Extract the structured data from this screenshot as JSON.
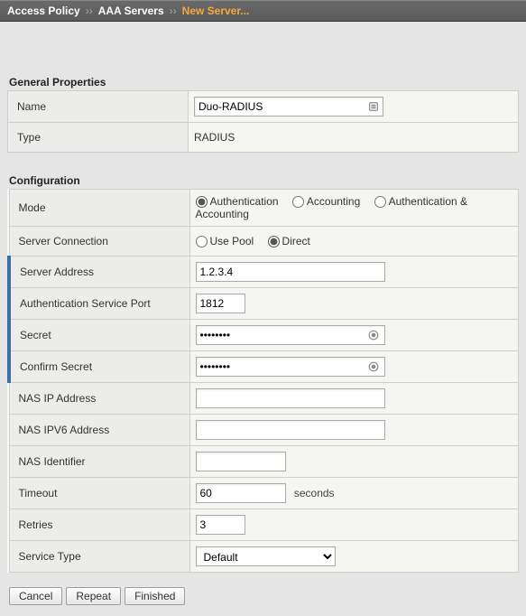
{
  "breadcrumb": {
    "seg1": "Access Policy",
    "seg2": "AAA Servers",
    "seg3": "New Server..."
  },
  "sections": {
    "general": {
      "title": "General Properties",
      "name_label": "Name",
      "name_value": "Duo-RADIUS",
      "type_label": "Type",
      "type_value": "RADIUS"
    },
    "config": {
      "title": "Configuration",
      "mode_label": "Mode",
      "mode_options": {
        "auth": "Authentication",
        "acct": "Accounting",
        "both": "Authentication & Accounting"
      },
      "server_conn_label": "Server Connection",
      "server_conn_options": {
        "pool": "Use Pool",
        "direct": "Direct"
      },
      "server_addr_label": "Server Address",
      "server_addr_value": "1.2.3.4",
      "auth_port_label": "Authentication Service Port",
      "auth_port_value": "1812",
      "secret_label": "Secret",
      "secret_value": "••••••••",
      "confirm_secret_label": "Confirm Secret",
      "confirm_secret_value": "••••••••",
      "nas_ip_label": "NAS IP Address",
      "nas_ip_value": "",
      "nas_ipv6_label": "NAS IPV6 Address",
      "nas_ipv6_value": "",
      "nas_id_label": "NAS Identifier",
      "nas_id_value": "",
      "timeout_label": "Timeout",
      "timeout_value": "60",
      "timeout_unit": "seconds",
      "retries_label": "Retries",
      "retries_value": "3",
      "svc_type_label": "Service Type",
      "svc_type_value": "Default"
    }
  },
  "buttons": {
    "cancel": "Cancel",
    "repeat": "Repeat",
    "finished": "Finished"
  }
}
